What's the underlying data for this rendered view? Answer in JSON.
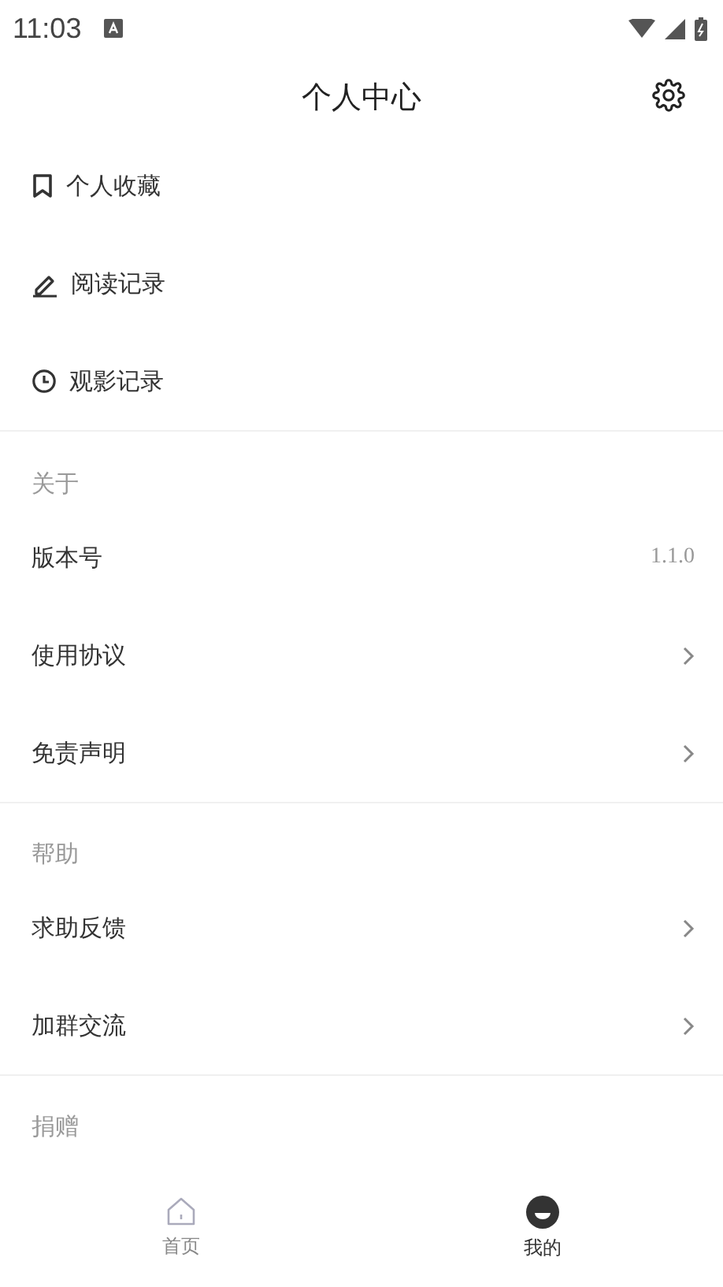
{
  "status_bar": {
    "time": "11:03"
  },
  "header": {
    "title": "个人中心"
  },
  "quick_links": [
    {
      "label": "个人收藏"
    },
    {
      "label": "阅读记录"
    },
    {
      "label": "观影记录"
    }
  ],
  "sections": [
    {
      "title": "关于",
      "rows": [
        {
          "label": "版本号",
          "kind": "value",
          "value": "1.1.0"
        },
        {
          "label": "使用协议",
          "kind": "link"
        },
        {
          "label": "免责声明",
          "kind": "link"
        }
      ]
    },
    {
      "title": "帮助",
      "rows": [
        {
          "label": "求助反馈",
          "kind": "link"
        },
        {
          "label": "加群交流",
          "kind": "link"
        }
      ]
    },
    {
      "title": "捐赠"
    }
  ],
  "tabs": [
    {
      "label": "首页",
      "selected": false
    },
    {
      "label": "我的",
      "selected": true
    }
  ]
}
